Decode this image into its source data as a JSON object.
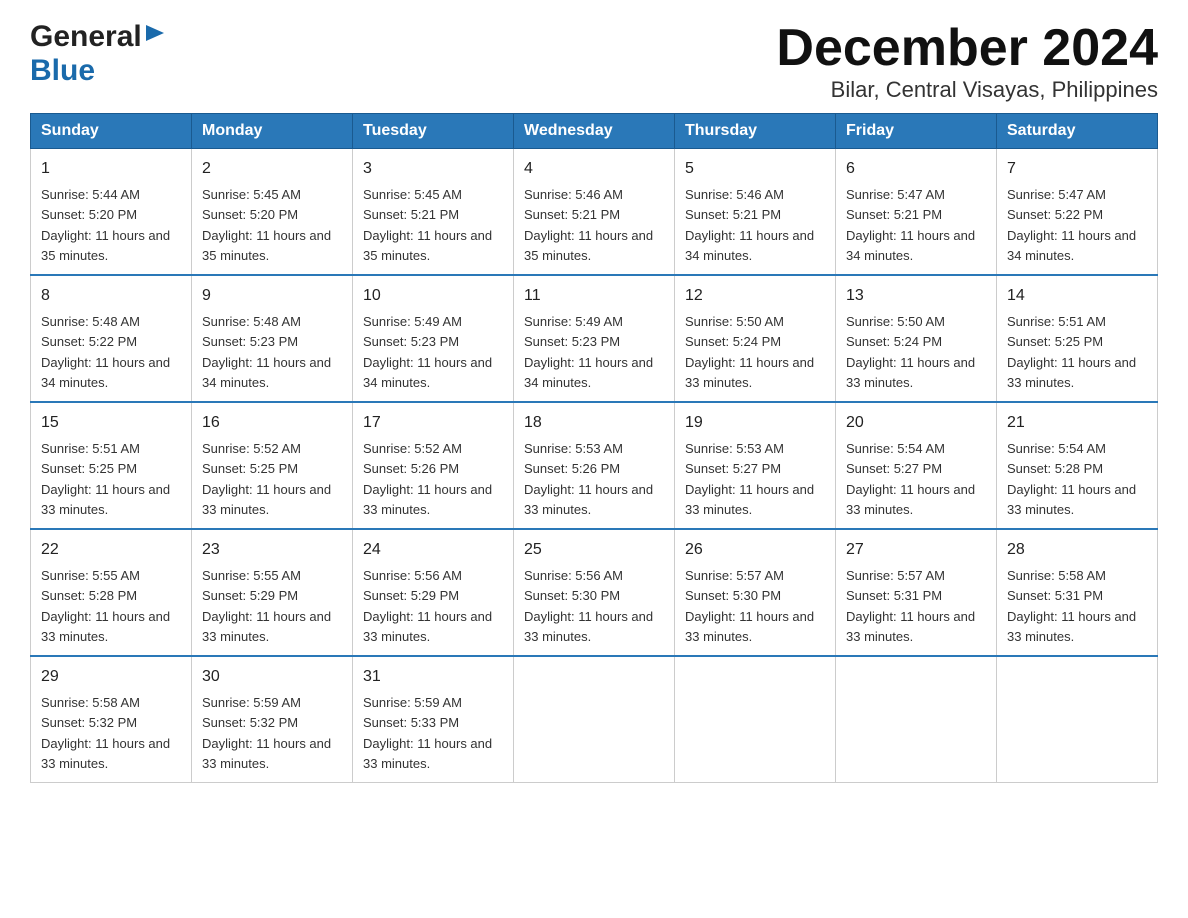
{
  "header": {
    "logo_general": "General",
    "logo_blue": "Blue",
    "title": "December 2024",
    "location": "Bilar, Central Visayas, Philippines"
  },
  "days_of_week": [
    "Sunday",
    "Monday",
    "Tuesday",
    "Wednesday",
    "Thursday",
    "Friday",
    "Saturday"
  ],
  "weeks": [
    [
      {
        "day": "1",
        "sunrise": "Sunrise: 5:44 AM",
        "sunset": "Sunset: 5:20 PM",
        "daylight": "Daylight: 11 hours and 35 minutes."
      },
      {
        "day": "2",
        "sunrise": "Sunrise: 5:45 AM",
        "sunset": "Sunset: 5:20 PM",
        "daylight": "Daylight: 11 hours and 35 minutes."
      },
      {
        "day": "3",
        "sunrise": "Sunrise: 5:45 AM",
        "sunset": "Sunset: 5:21 PM",
        "daylight": "Daylight: 11 hours and 35 minutes."
      },
      {
        "day": "4",
        "sunrise": "Sunrise: 5:46 AM",
        "sunset": "Sunset: 5:21 PM",
        "daylight": "Daylight: 11 hours and 35 minutes."
      },
      {
        "day": "5",
        "sunrise": "Sunrise: 5:46 AM",
        "sunset": "Sunset: 5:21 PM",
        "daylight": "Daylight: 11 hours and 34 minutes."
      },
      {
        "day": "6",
        "sunrise": "Sunrise: 5:47 AM",
        "sunset": "Sunset: 5:21 PM",
        "daylight": "Daylight: 11 hours and 34 minutes."
      },
      {
        "day": "7",
        "sunrise": "Sunrise: 5:47 AM",
        "sunset": "Sunset: 5:22 PM",
        "daylight": "Daylight: 11 hours and 34 minutes."
      }
    ],
    [
      {
        "day": "8",
        "sunrise": "Sunrise: 5:48 AM",
        "sunset": "Sunset: 5:22 PM",
        "daylight": "Daylight: 11 hours and 34 minutes."
      },
      {
        "day": "9",
        "sunrise": "Sunrise: 5:48 AM",
        "sunset": "Sunset: 5:23 PM",
        "daylight": "Daylight: 11 hours and 34 minutes."
      },
      {
        "day": "10",
        "sunrise": "Sunrise: 5:49 AM",
        "sunset": "Sunset: 5:23 PM",
        "daylight": "Daylight: 11 hours and 34 minutes."
      },
      {
        "day": "11",
        "sunrise": "Sunrise: 5:49 AM",
        "sunset": "Sunset: 5:23 PM",
        "daylight": "Daylight: 11 hours and 34 minutes."
      },
      {
        "day": "12",
        "sunrise": "Sunrise: 5:50 AM",
        "sunset": "Sunset: 5:24 PM",
        "daylight": "Daylight: 11 hours and 33 minutes."
      },
      {
        "day": "13",
        "sunrise": "Sunrise: 5:50 AM",
        "sunset": "Sunset: 5:24 PM",
        "daylight": "Daylight: 11 hours and 33 minutes."
      },
      {
        "day": "14",
        "sunrise": "Sunrise: 5:51 AM",
        "sunset": "Sunset: 5:25 PM",
        "daylight": "Daylight: 11 hours and 33 minutes."
      }
    ],
    [
      {
        "day": "15",
        "sunrise": "Sunrise: 5:51 AM",
        "sunset": "Sunset: 5:25 PM",
        "daylight": "Daylight: 11 hours and 33 minutes."
      },
      {
        "day": "16",
        "sunrise": "Sunrise: 5:52 AM",
        "sunset": "Sunset: 5:25 PM",
        "daylight": "Daylight: 11 hours and 33 minutes."
      },
      {
        "day": "17",
        "sunrise": "Sunrise: 5:52 AM",
        "sunset": "Sunset: 5:26 PM",
        "daylight": "Daylight: 11 hours and 33 minutes."
      },
      {
        "day": "18",
        "sunrise": "Sunrise: 5:53 AM",
        "sunset": "Sunset: 5:26 PM",
        "daylight": "Daylight: 11 hours and 33 minutes."
      },
      {
        "day": "19",
        "sunrise": "Sunrise: 5:53 AM",
        "sunset": "Sunset: 5:27 PM",
        "daylight": "Daylight: 11 hours and 33 minutes."
      },
      {
        "day": "20",
        "sunrise": "Sunrise: 5:54 AM",
        "sunset": "Sunset: 5:27 PM",
        "daylight": "Daylight: 11 hours and 33 minutes."
      },
      {
        "day": "21",
        "sunrise": "Sunrise: 5:54 AM",
        "sunset": "Sunset: 5:28 PM",
        "daylight": "Daylight: 11 hours and 33 minutes."
      }
    ],
    [
      {
        "day": "22",
        "sunrise": "Sunrise: 5:55 AM",
        "sunset": "Sunset: 5:28 PM",
        "daylight": "Daylight: 11 hours and 33 minutes."
      },
      {
        "day": "23",
        "sunrise": "Sunrise: 5:55 AM",
        "sunset": "Sunset: 5:29 PM",
        "daylight": "Daylight: 11 hours and 33 minutes."
      },
      {
        "day": "24",
        "sunrise": "Sunrise: 5:56 AM",
        "sunset": "Sunset: 5:29 PM",
        "daylight": "Daylight: 11 hours and 33 minutes."
      },
      {
        "day": "25",
        "sunrise": "Sunrise: 5:56 AM",
        "sunset": "Sunset: 5:30 PM",
        "daylight": "Daylight: 11 hours and 33 minutes."
      },
      {
        "day": "26",
        "sunrise": "Sunrise: 5:57 AM",
        "sunset": "Sunset: 5:30 PM",
        "daylight": "Daylight: 11 hours and 33 minutes."
      },
      {
        "day": "27",
        "sunrise": "Sunrise: 5:57 AM",
        "sunset": "Sunset: 5:31 PM",
        "daylight": "Daylight: 11 hours and 33 minutes."
      },
      {
        "day": "28",
        "sunrise": "Sunrise: 5:58 AM",
        "sunset": "Sunset: 5:31 PM",
        "daylight": "Daylight: 11 hours and 33 minutes."
      }
    ],
    [
      {
        "day": "29",
        "sunrise": "Sunrise: 5:58 AM",
        "sunset": "Sunset: 5:32 PM",
        "daylight": "Daylight: 11 hours and 33 minutes."
      },
      {
        "day": "30",
        "sunrise": "Sunrise: 5:59 AM",
        "sunset": "Sunset: 5:32 PM",
        "daylight": "Daylight: 11 hours and 33 minutes."
      },
      {
        "day": "31",
        "sunrise": "Sunrise: 5:59 AM",
        "sunset": "Sunset: 5:33 PM",
        "daylight": "Daylight: 11 hours and 33 minutes."
      },
      null,
      null,
      null,
      null
    ]
  ]
}
